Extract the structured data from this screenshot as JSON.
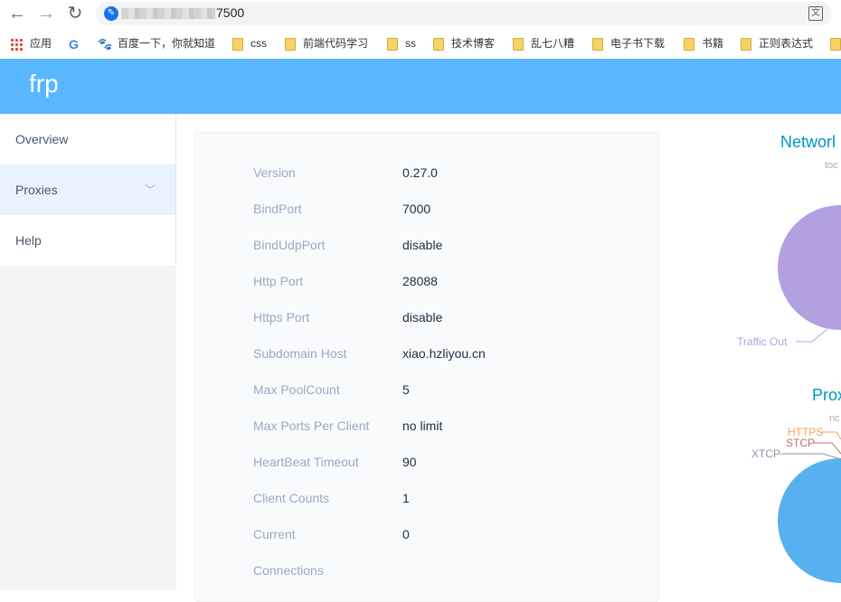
{
  "browser": {
    "url_suffix": "7500",
    "bookmarks": [
      {
        "label": "应用",
        "icon": "apps-grid-icon"
      },
      {
        "label": "",
        "icon": "google-icon"
      },
      {
        "label": "百度一下，你就知道",
        "icon": "baidu-icon"
      },
      {
        "label": "css",
        "icon": "folder-icon"
      },
      {
        "label": "前端代码学习",
        "icon": "folder-icon"
      },
      {
        "label": "ss",
        "icon": "folder-icon"
      },
      {
        "label": "技术博客",
        "icon": "folder-icon"
      },
      {
        "label": "乱七八糟",
        "icon": "folder-icon"
      },
      {
        "label": "电子书下载",
        "icon": "folder-icon"
      },
      {
        "label": "书籍",
        "icon": "folder-icon"
      },
      {
        "label": "正则表达式",
        "icon": "folder-icon"
      }
    ]
  },
  "app": {
    "brand": "frp",
    "header_color": "#58b7ff"
  },
  "sidebar": {
    "items": [
      {
        "label": "Overview"
      },
      {
        "label": "Proxies"
      },
      {
        "label": "Help"
      }
    ]
  },
  "overview": {
    "rows": [
      {
        "label": "Version",
        "value": "0.27.0"
      },
      {
        "label": "BindPort",
        "value": "7000"
      },
      {
        "label": "BindUdpPort",
        "value": "disable"
      },
      {
        "label": "Http Port",
        "value": "28088"
      },
      {
        "label": "Https Port",
        "value": "disable"
      },
      {
        "label": "Subdomain Host",
        "value": "xiao.hzliyou.cn"
      },
      {
        "label": "Max PoolCount",
        "value": "5"
      },
      {
        "label": "Max Ports Per Client",
        "value": "no limit"
      },
      {
        "label": "HeartBeat Timeout",
        "value": "90"
      },
      {
        "label": "Client Counts",
        "value": "1"
      },
      {
        "label": "Current",
        "value": "0"
      },
      {
        "label": "Connections",
        "value": ""
      }
    ]
  },
  "charts": {
    "network": {
      "title_visible": "Networl",
      "subtitle_visible": "toc",
      "legend_label": "Traffic Out",
      "color": "#b39ddb"
    },
    "proxies": {
      "title_visible": "Prox",
      "subtitle_visible": "nc",
      "labels": [
        "HTTPS",
        "STCP",
        "XTCP"
      ],
      "label_colors": [
        "#f5a35c",
        "#c86a6a",
        "#8a94a6"
      ],
      "color": "#58b0f0"
    }
  }
}
